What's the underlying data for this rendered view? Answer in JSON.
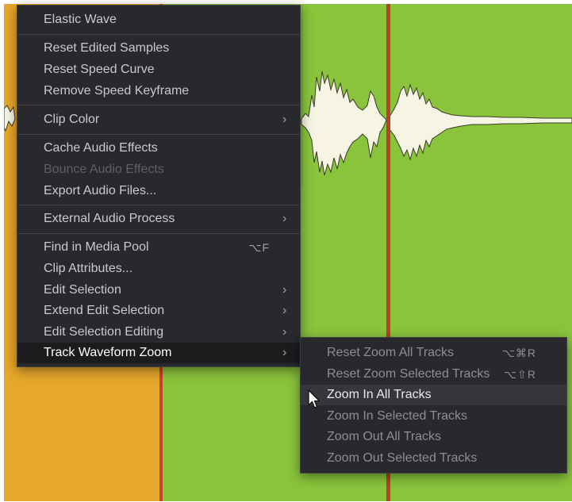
{
  "main_menu": {
    "items": [
      {
        "label": "Elastic Wave"
      },
      {
        "label": "Reset Edited Samples"
      },
      {
        "label": "Reset Speed Curve"
      },
      {
        "label": "Remove Speed Keyframe"
      },
      {
        "label": "Clip Color",
        "submenu": true
      },
      {
        "label": "Cache Audio Effects"
      },
      {
        "label": "Bounce Audio Effects",
        "disabled": true
      },
      {
        "label": "Export Audio Files..."
      },
      {
        "label": "External Audio Process",
        "submenu": true
      },
      {
        "label": "Find in Media Pool",
        "shortcut": "⌥F"
      },
      {
        "label": "Clip Attributes..."
      },
      {
        "label": "Edit Selection",
        "submenu": true
      },
      {
        "label": "Extend Edit Selection",
        "submenu": true
      },
      {
        "label": "Edit Selection Editing",
        "submenu": true
      },
      {
        "label": "Track Waveform Zoom",
        "submenu": true,
        "selected": true
      }
    ]
  },
  "sub_menu": {
    "items": [
      {
        "label": "Reset Zoom All Tracks",
        "shortcut": "⌥⌘R"
      },
      {
        "label": "Reset Zoom Selected Tracks",
        "shortcut": "⌥⇧R"
      },
      {
        "label": "Zoom In All Tracks",
        "highlighted": true
      },
      {
        "label": "Zoom In Selected Tracks"
      },
      {
        "label": "Zoom Out All Tracks"
      },
      {
        "label": "Zoom Out Selected Tracks"
      }
    ]
  },
  "icons": {
    "submenu_arrow": "chevron-right-icon",
    "pointer": "mouse-pointer-icon"
  },
  "colors": {
    "track_green": "#8ac43c",
    "clip_orange": "#e6a72a",
    "playhead_red": "#b9412a",
    "waveform_fill": "#f6f5e3",
    "menu_bg": "#28292d"
  }
}
